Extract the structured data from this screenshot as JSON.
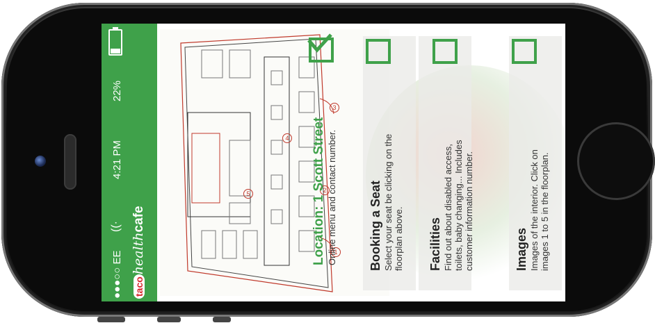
{
  "status": {
    "carrier": "●●●○○ EE",
    "time": "4:21 PM",
    "battery": "22%",
    "battery_level": 0.22
  },
  "brand": {
    "part1": "taco",
    "part2": "health",
    "part3": "cafe"
  },
  "location": {
    "title": "Location: 1 Scott Street",
    "subtitle": "Online menu and contact number."
  },
  "sections": [
    {
      "title": "Booking a Seat",
      "desc_l1": "Select your seat be clicking on the",
      "desc_l2": "floorplan above."
    },
    {
      "title": "Facilities",
      "desc_l1": "Find out about disabled access,",
      "desc_l2": "toilets, baby changing... Includes",
      "desc_l3": "customer information number."
    },
    {
      "title": "Images",
      "desc_l1": "Images of the interior. Click on",
      "desc_l2": "images 1 to 5 in the floorplan."
    }
  ],
  "plan_markers": [
    "1",
    "2",
    "3",
    "4",
    "5"
  ],
  "colors": {
    "accent": "#3fa14a",
    "phone": "#111111"
  }
}
